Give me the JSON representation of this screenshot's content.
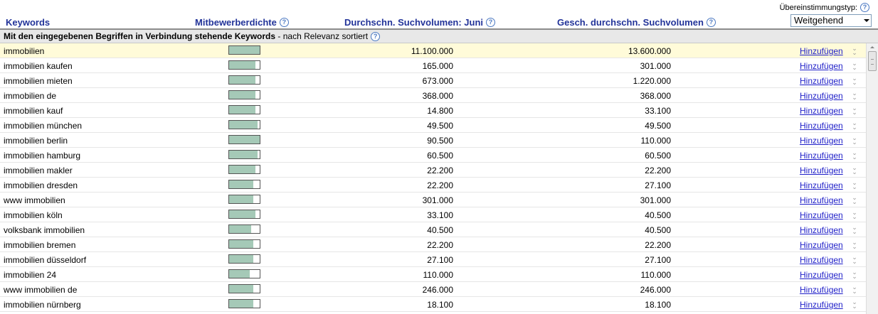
{
  "header": {
    "col_keywords": "Keywords",
    "col_competition": "Mitbewerberdichte",
    "col_volume_june": "Durchschn. Suchvolumen: Juni",
    "col_volume_est": "Gesch. durchschn. Suchvolumen",
    "match_type_label": "Übereinstimmungstyp:",
    "match_type_value": "Weitgehend"
  },
  "section": {
    "title": "Mit den eingegebenen Begriffen in Verbindung stehende Keywords",
    "subtitle": " - nach Relevanz sortiert"
  },
  "add_label": "Hinzufügen",
  "rows": [
    {
      "keyword": "immobilien",
      "competition": 1.0,
      "june": "11.100.000",
      "estimated": "13.600.000"
    },
    {
      "keyword": "immobilien kaufen",
      "competition": 0.87,
      "june": "165.000",
      "estimated": "301.000"
    },
    {
      "keyword": "immobilien mieten",
      "competition": 0.87,
      "june": "673.000",
      "estimated": "1.220.000"
    },
    {
      "keyword": "immobilien de",
      "competition": 0.87,
      "june": "368.000",
      "estimated": "368.000"
    },
    {
      "keyword": "immobilien kauf",
      "competition": 0.87,
      "june": "14.800",
      "estimated": "33.100"
    },
    {
      "keyword": "immobilien münchen",
      "competition": 0.93,
      "june": "49.500",
      "estimated": "49.500"
    },
    {
      "keyword": "immobilien berlin",
      "competition": 1.0,
      "june": "90.500",
      "estimated": "110.000"
    },
    {
      "keyword": "immobilien hamburg",
      "competition": 0.93,
      "june": "60.500",
      "estimated": "60.500"
    },
    {
      "keyword": "immobilien makler",
      "competition": 0.87,
      "june": "22.200",
      "estimated": "22.200"
    },
    {
      "keyword": "immobilien dresden",
      "competition": 0.8,
      "june": "22.200",
      "estimated": "27.100"
    },
    {
      "keyword": "www immobilien",
      "competition": 0.8,
      "june": "301.000",
      "estimated": "301.000"
    },
    {
      "keyword": "immobilien köln",
      "competition": 0.87,
      "june": "33.100",
      "estimated": "40.500"
    },
    {
      "keyword": "volksbank immobilien",
      "competition": 0.73,
      "june": "40.500",
      "estimated": "40.500"
    },
    {
      "keyword": "immobilien bremen",
      "competition": 0.8,
      "june": "22.200",
      "estimated": "22.200"
    },
    {
      "keyword": "immobilien düsseldorf",
      "competition": 0.8,
      "june": "27.100",
      "estimated": "27.100"
    },
    {
      "keyword": "immobilien 24",
      "competition": 0.67,
      "june": "110.000",
      "estimated": "110.000"
    },
    {
      "keyword": "www immobilien de",
      "competition": 0.8,
      "june": "246.000",
      "estimated": "246.000"
    },
    {
      "keyword": "immobilien nürnberg",
      "competition": 0.8,
      "june": "18.100",
      "estimated": "18.100"
    }
  ]
}
